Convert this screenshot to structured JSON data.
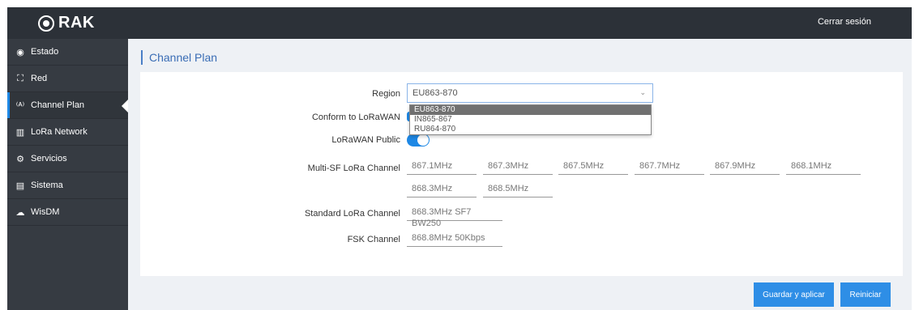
{
  "header": {
    "logo_text": "RAK",
    "logout_label": "Cerrar sesión"
  },
  "sidebar": {
    "items": [
      {
        "label": "Estado",
        "icon": "dashboard-icon"
      },
      {
        "label": "Red",
        "icon": "network-icon"
      },
      {
        "label": "Channel Plan",
        "icon": "antenna-icon"
      },
      {
        "label": "LoRa Network",
        "icon": "signal-bars-icon"
      },
      {
        "label": "Servicios",
        "icon": "gears-icon"
      },
      {
        "label": "Sistema",
        "icon": "system-list-icon"
      },
      {
        "label": "WisDM",
        "icon": "cloud-icon"
      }
    ]
  },
  "page": {
    "title": "Channel Plan"
  },
  "form": {
    "region_label": "Region",
    "region_value": "EU863-870",
    "region_options": [
      "EU863-870",
      "IN865-867",
      "RU864-870"
    ],
    "conform_label": "Conform to LoRaWAN",
    "public_label": "LoRaWAN Public",
    "public_on": true,
    "multisf_label": "Multi-SF LoRa Channel",
    "multisf_channels": [
      "867.1MHz",
      "867.3MHz",
      "867.5MHz",
      "867.7MHz",
      "867.9MHz",
      "868.1MHz",
      "868.3MHz",
      "868.5MHz"
    ],
    "standard_label": "Standard LoRa Channel",
    "standard_value": "868.3MHz SF7 BW250",
    "fsk_label": "FSK Channel",
    "fsk_value": "868.8MHz 50Kbps"
  },
  "actions": {
    "save_label": "Guardar y aplicar",
    "restart_label": "Reiniciar"
  },
  "colors": {
    "accent": "#2e8ee6",
    "topbar": "#2c3138",
    "sidebar": "#363b42"
  }
}
